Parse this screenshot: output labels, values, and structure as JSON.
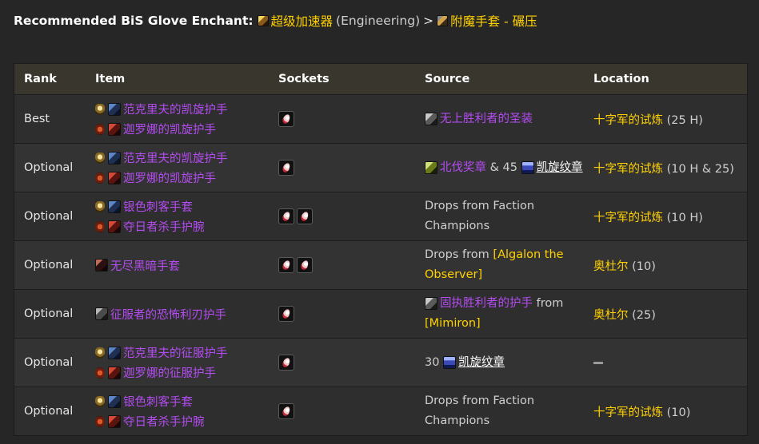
{
  "heading": {
    "label": "Recommended BiS Glove Enchant",
    "colon": ":",
    "enchant": "超级加速器",
    "profession": "(Engineering)",
    "separator": ">",
    "alt_enchant": "附魔手套 - 碾压"
  },
  "table": {
    "headers": [
      "Rank",
      "Item",
      "Sockets",
      "Source",
      "Location"
    ],
    "rows": [
      {
        "rank": "Best",
        "items": [
          {
            "faction": "alliance",
            "icon": "glove-blue-icon",
            "name": "范克里夫的凯旋护手"
          },
          {
            "faction": "horde",
            "icon": "glove-red-icon",
            "name": "迦罗娜的凯旋护手"
          }
        ],
        "sockets": 1,
        "source": {
          "pre_icon": "armor-gray-icon",
          "link": "无上胜利者的圣装"
        },
        "location": {
          "name": "十字军的试炼",
          "detail": "(25 H)"
        }
      },
      {
        "rank": "Optional",
        "items": [
          {
            "faction": "alliance",
            "icon": "glove-blue-icon",
            "name": "范克里夫的凯旋护手"
          },
          {
            "faction": "horde",
            "icon": "glove-red-icon",
            "name": "迦罗娜的凯旋护手"
          }
        ],
        "sockets": 1,
        "source": {
          "pre_icon": "armor-green-icon",
          "link": "北伐奖章",
          "amp": "& 45",
          "badge_icon": "badge-blue-icon",
          "badge_link": "凯旋纹章"
        },
        "location": {
          "name": "十字军的试炼",
          "detail": "(10 H & 25)"
        }
      },
      {
        "rank": "Optional",
        "items": [
          {
            "faction": "alliance",
            "icon": "glove-blue-icon",
            "name": "银色刺客手套"
          },
          {
            "faction": "horde",
            "icon": "glove-red-icon",
            "name": "夺日者杀手护腕"
          }
        ],
        "sockets": 2,
        "source": {
          "text": "Drops from Faction Champions"
        },
        "location": {
          "name": "十字军的试炼",
          "detail": "(10 H)"
        }
      },
      {
        "rank": "Optional",
        "items": [
          {
            "icon": "glove-dark-icon",
            "name": "无尽黑暗手套"
          }
        ],
        "sockets": 2,
        "source": {
          "text": "Drops from",
          "boss": "[Algalon the Observer]"
        },
        "location": {
          "name": "奥杜尔",
          "detail": "(10)"
        }
      },
      {
        "rank": "Optional",
        "items": [
          {
            "icon": "glove-gray-icon",
            "name": "征服者的恐怖利刃护手"
          }
        ],
        "sockets": 1,
        "source": {
          "pre_icon": "armor-gray-icon",
          "link": "固执胜利者的护手",
          "from": "from",
          "boss": "[Mimiron]"
        },
        "location": {
          "name": "奥杜尔",
          "detail": "(25)"
        }
      },
      {
        "rank": "Optional",
        "items": [
          {
            "faction": "alliance",
            "icon": "glove-blue-icon",
            "name": "范克里夫的征服护手"
          },
          {
            "faction": "horde",
            "icon": "glove-red-icon",
            "name": "迦罗娜的征服护手"
          }
        ],
        "sockets": 1,
        "source": {
          "count": "30",
          "badge_icon": "badge-blue-icon",
          "badge_link": "凯旋纹章"
        },
        "location": {
          "dash": true
        }
      },
      {
        "rank": "Optional",
        "items": [
          {
            "faction": "alliance",
            "icon": "glove-blue-icon",
            "name": "银色刺客手套"
          },
          {
            "faction": "horde",
            "icon": "glove-red-icon",
            "name": "夺日者杀手护腕"
          }
        ],
        "sockets": 1,
        "source": {
          "text": "Drops from Faction Champions"
        },
        "location": {
          "name": "十字军的试炼",
          "detail": "(10)"
        }
      }
    ]
  }
}
